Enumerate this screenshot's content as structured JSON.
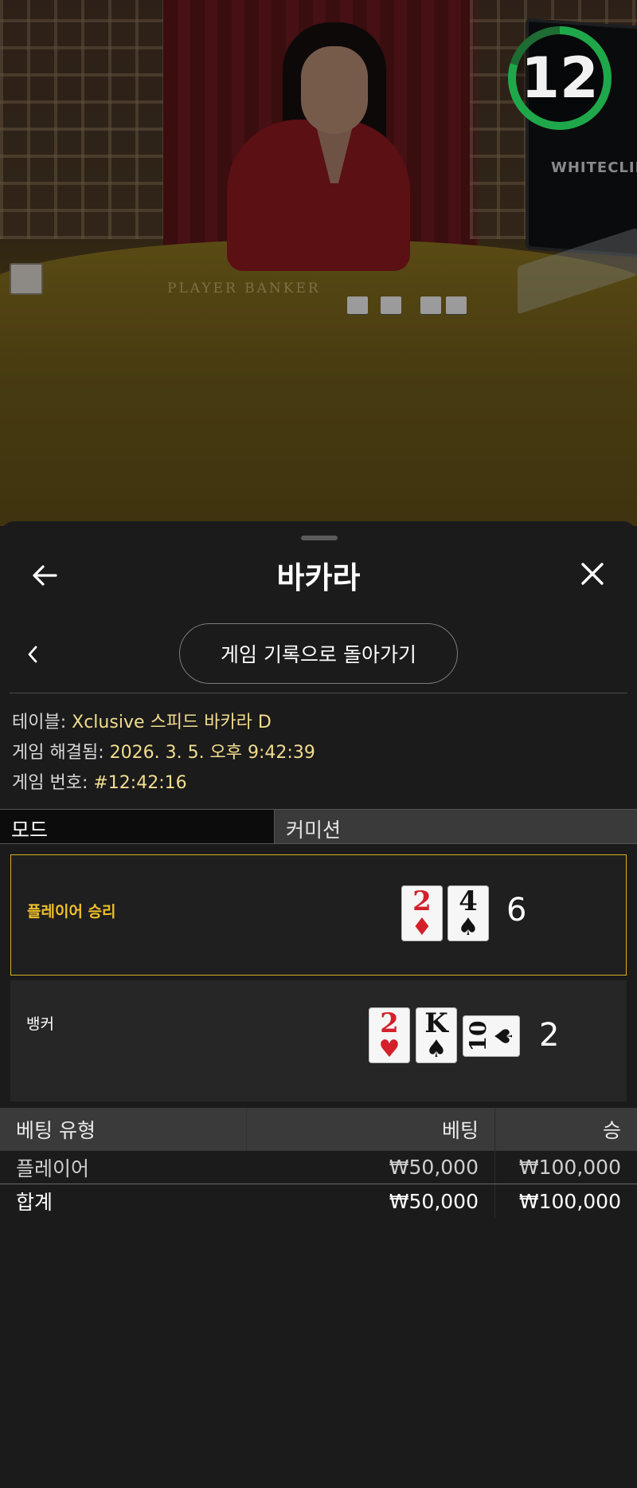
{
  "video": {
    "timer": "12",
    "felt_text": "PLAYER BANKER",
    "monitor_brand": "WHITECLIFF"
  },
  "panel": {
    "title": "바카라",
    "history_button": "게임 기록으로 돌아가기",
    "info": {
      "table_label": "테이블: ",
      "table_value": "Xclusive 스피드 바카라 D",
      "resolved_label": "게임 해결됨: ",
      "resolved_value": "2026. 3. 5. 오후 9:42:39",
      "number_label": "게임 번호: ",
      "number_value": "#12:42:16"
    },
    "mode": {
      "left": "모드",
      "right": "커미션"
    },
    "player": {
      "label": "플레이어 승리",
      "score": "6",
      "cards": [
        {
          "rank": "2",
          "suit": "♦",
          "color": "red"
        },
        {
          "rank": "4",
          "suit": "♠",
          "color": "black"
        }
      ]
    },
    "banker": {
      "label": "뱅커",
      "score": "2",
      "cards": [
        {
          "rank": "2",
          "suit": "♥",
          "color": "red"
        },
        {
          "rank": "K",
          "suit": "♠",
          "color": "black"
        },
        {
          "rank": "10",
          "suit": "♠",
          "color": "black"
        }
      ]
    },
    "bets": {
      "headers": [
        "베팅 유형",
        "베팅",
        "승"
      ],
      "rows": [
        {
          "type": "플레이어",
          "bet": "₩50,000",
          "win": "₩100,000"
        }
      ],
      "total": {
        "type": "합계",
        "bet": "₩50,000",
        "win": "₩100,000"
      }
    }
  },
  "colors": {
    "accent_gold": "#d4b21e",
    "value_text": "#f2dd8f",
    "timer_ring": "#1fa84a"
  }
}
